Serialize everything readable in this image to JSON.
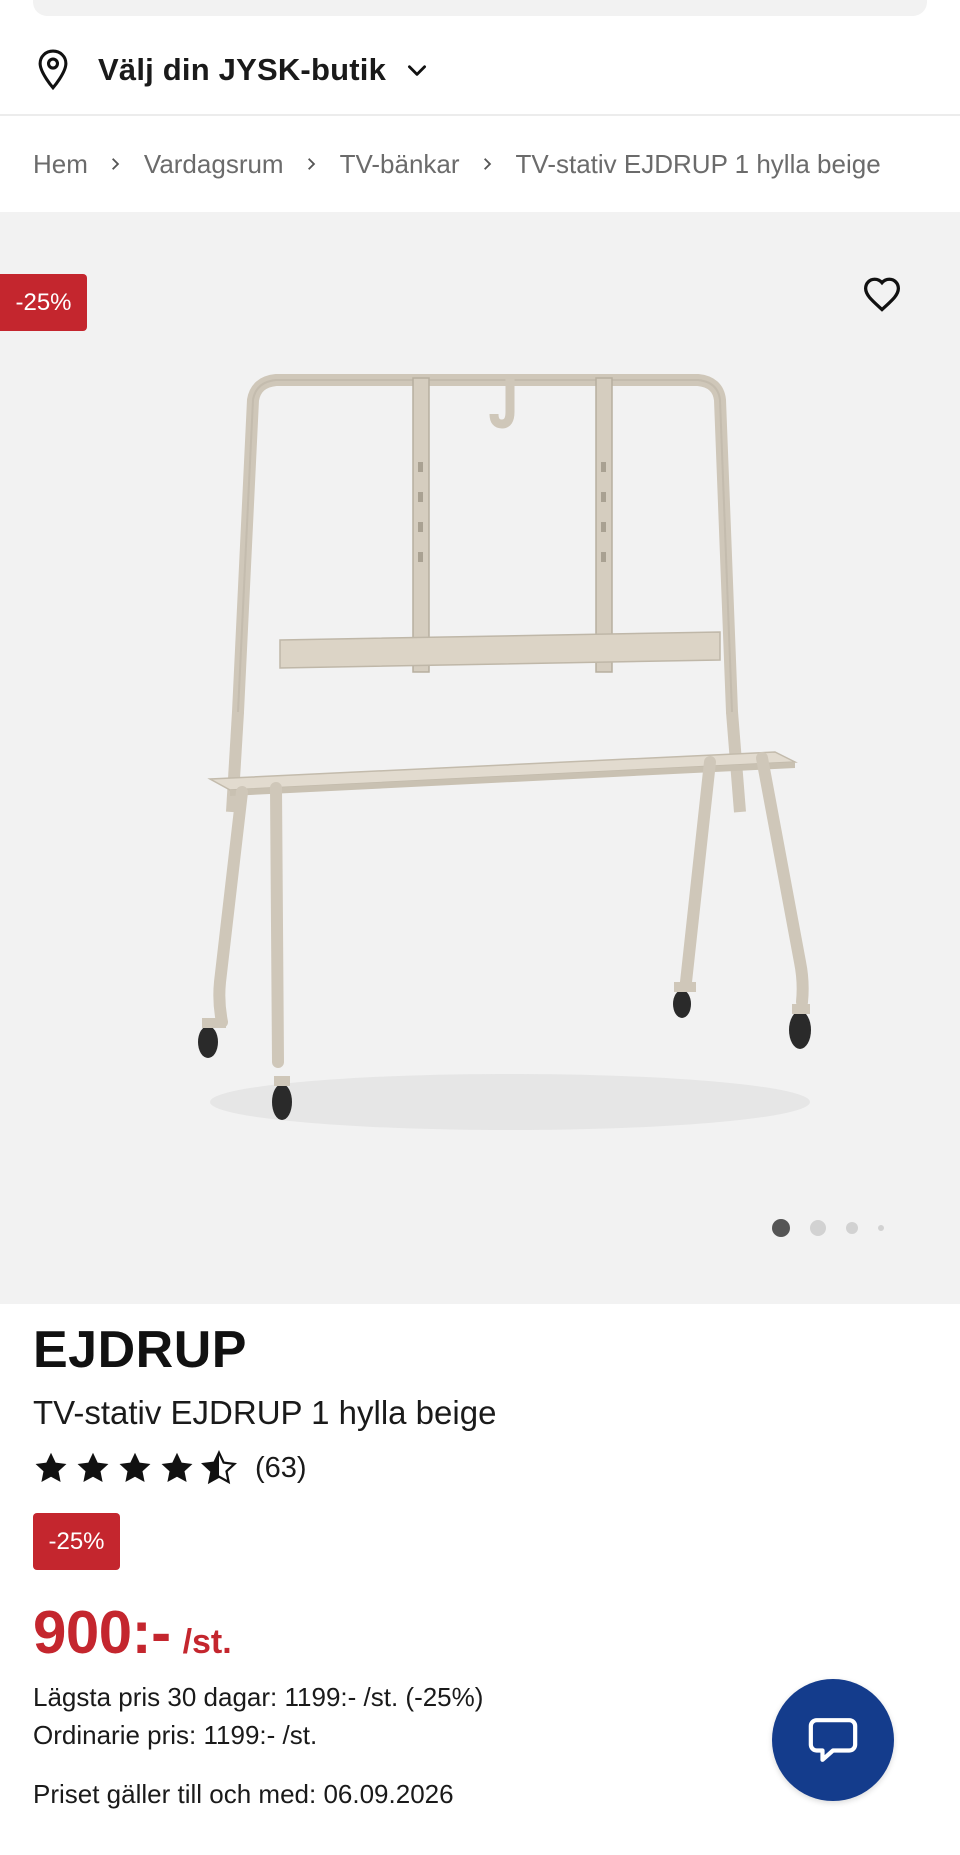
{
  "header": {
    "store_selector": {
      "label": "Välj din JYSK-butik",
      "icon": "location-pin-icon",
      "dropdown_icon": "chevron-down-icon"
    }
  },
  "breadcrumb": [
    {
      "label": "Hem"
    },
    {
      "label": "Vardagsrum"
    },
    {
      "label": "TV-bänkar"
    },
    {
      "label": "TV-stativ EJDRUP 1 hylla beige"
    }
  ],
  "gallery": {
    "discount_badge": "-25%",
    "favorite_icon": "heart-icon",
    "slide_count": 4,
    "active_slide": 1
  },
  "product": {
    "brand": "EJDRUP",
    "name": "TV-stativ EJDRUP 1 hylla beige",
    "rating": 4.5,
    "rating_max": 5,
    "review_count": "(63)",
    "discount_badge": "-25%",
    "price": "900:-",
    "price_unit": "/st.",
    "lowest_price_30_days": "Lägsta pris 30 dagar: 1199:- /st. (-25%)",
    "regular_price": "Ordinarie pris: 1199:- /st.",
    "price_valid_until": "Priset gäller till och med: 06.09.2026"
  },
  "chat": {
    "icon": "chat-bubble-icon"
  },
  "colors": {
    "sale_red": "#c4262e",
    "chat_blue": "#143c8c",
    "gallery_bg": "#f2f2f2",
    "breadcrumb_gray": "#6b6b6b"
  }
}
